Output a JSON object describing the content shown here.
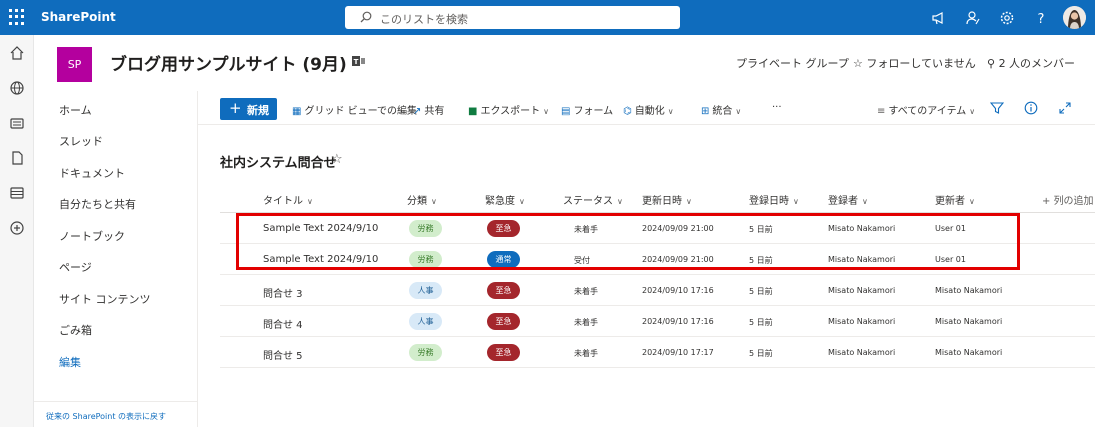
{
  "suite": {
    "brand": "SharePoint",
    "search_placeholder": "このリストを検索"
  },
  "site": {
    "logo_text": "SP",
    "title": "ブログ用サンプルサイト (9月)",
    "private_group": "プライベート グループ",
    "follow": "フォローしていません",
    "members": "2 人のメンバー"
  },
  "nav": {
    "items": [
      "ホーム",
      "スレッド",
      "ドキュメント",
      "自分たちと共有",
      "ノートブック",
      "ページ",
      "サイト コンテンツ",
      "ごみ箱"
    ],
    "edit": "編集",
    "footer": "従来の SharePoint の表示に戻す"
  },
  "commands": {
    "new": "新規",
    "grid_edit": "グリッド ビューでの編集",
    "share": "共有",
    "export": "エクスポート",
    "forms": "フォーム",
    "automate": "自動化",
    "integrate": "統合",
    "more": "···",
    "view": "すべてのアイテム"
  },
  "list": {
    "title": "社内システム問合せ",
    "columns": [
      "タイトル",
      "分類",
      "緊急度",
      "ステータス",
      "更新日時",
      "登録日時",
      "登録者",
      "更新者"
    ],
    "add_column": "列の追加",
    "rows": [
      {
        "title": "Sample Text 2024/9/10",
        "category": "労務",
        "urgency": "至急",
        "status": "未着手",
        "modified": "2024/09/09 21:00",
        "created": "5 日前",
        "created_by": "Misato Nakamori",
        "modified_by": "User 01"
      },
      {
        "title": "Sample Text 2024/9/10",
        "category": "労務",
        "urgency": "通常",
        "status": "受付",
        "modified": "2024/09/09 21:00",
        "created": "5 日前",
        "created_by": "Misato Nakamori",
        "modified_by": "User 01"
      },
      {
        "title": "問合せ 3",
        "category": "人事",
        "urgency": "至急",
        "status": "未着手",
        "modified": "2024/09/10 17:16",
        "created": "5 日前",
        "created_by": "Misato Nakamori",
        "modified_by": "Misato Nakamori"
      },
      {
        "title": "問合せ 4",
        "category": "人事",
        "urgency": "至急",
        "status": "未着手",
        "modified": "2024/09/10 17:16",
        "created": "5 日前",
        "created_by": "Misato Nakamori",
        "modified_by": "Misato Nakamori"
      },
      {
        "title": "問合せ 5",
        "category": "労務",
        "urgency": "至急",
        "status": "未着手",
        "modified": "2024/09/10 17:17",
        "created": "5 日前",
        "created_by": "Misato Nakamori",
        "modified_by": "Misato Nakamori"
      }
    ]
  },
  "colors": {
    "suite_bar": "#0f6cbd",
    "site_logo": "#b4009e",
    "urgent": "#a4262c",
    "normal": "#0f6cbd",
    "highlight": "#e20000"
  },
  "icons": [
    "waffle-icon",
    "search-icon",
    "megaphone-icon",
    "feedback-icon",
    "settings-icon",
    "help-icon",
    "home-icon",
    "globe-icon",
    "news-icon",
    "files-icon",
    "lists-icon",
    "add-icon",
    "teams-icon",
    "star-icon",
    "person-icon",
    "grid-icon",
    "share-icon",
    "excel-icon",
    "forms-icon",
    "flow-icon",
    "integrate-icon",
    "filter-icon",
    "info-icon",
    "expand-icon"
  ]
}
